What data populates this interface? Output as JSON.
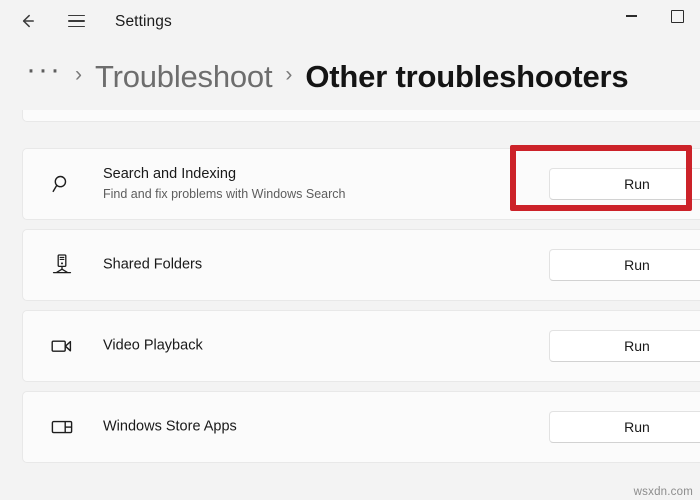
{
  "window": {
    "title": "Settings",
    "back_icon": "back-arrow-icon",
    "menu_icon": "hamburger-menu-icon",
    "minimize_label": "Minimize",
    "maximize_label": "Maximize"
  },
  "breadcrumb": {
    "overflow": "···",
    "separator": "›",
    "parent": "Troubleshoot",
    "current": "Other troubleshooters"
  },
  "rows": [
    {
      "title": "Search and Indexing",
      "subtitle": "Find and fix problems with Windows Search",
      "icon": "search-icon",
      "button": "Run",
      "highlighted": true
    },
    {
      "title": "Shared Folders",
      "subtitle": "",
      "icon": "shared-folders-icon",
      "button": "Run",
      "highlighted": false
    },
    {
      "title": "Video Playback",
      "subtitle": "",
      "icon": "video-camera-icon",
      "button": "Run",
      "highlighted": false
    },
    {
      "title": "Windows Store Apps",
      "subtitle": "",
      "icon": "store-apps-icon",
      "button": "Run",
      "highlighted": false
    }
  ],
  "annotation": {
    "color": "#cc2229",
    "target": "Run button for Search and Indexing"
  },
  "watermark": "wsxdn.com"
}
